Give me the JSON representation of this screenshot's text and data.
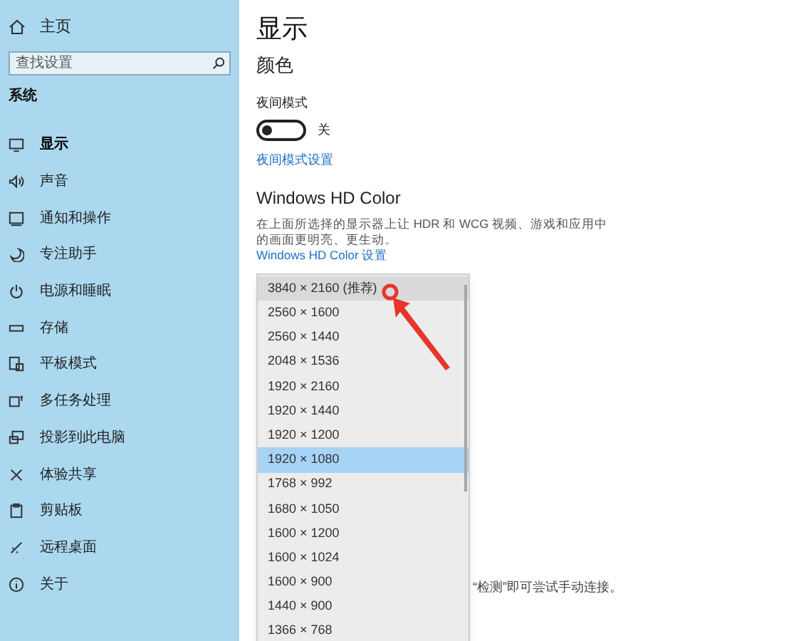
{
  "sidebar": {
    "home": "主页",
    "search": {
      "placeholder": "查找设置"
    },
    "section": "系统",
    "items": [
      {
        "label": "显示",
        "selected": true
      },
      {
        "label": "声音",
        "selected": false
      },
      {
        "label": "通知和操作",
        "selected": false
      },
      {
        "label": "专注助手",
        "selected": false
      },
      {
        "label": "电源和睡眠",
        "selected": false
      },
      {
        "label": "存储",
        "selected": false
      },
      {
        "label": "平板模式",
        "selected": false
      },
      {
        "label": "多任务处理",
        "selected": false
      },
      {
        "label": "投影到此电脑",
        "selected": false
      },
      {
        "label": "体验共享",
        "selected": false
      },
      {
        "label": "剪贴板",
        "selected": false
      },
      {
        "label": "远程桌面",
        "selected": false
      },
      {
        "label": "关于",
        "selected": false
      }
    ]
  },
  "content": {
    "title": "显示",
    "color_heading": "颜色",
    "night_light": {
      "label": "夜间模式",
      "on": false,
      "state": "关"
    },
    "night_link": "夜间模式设置",
    "hd_heading": "Windows HD Color",
    "hd_text": "在上面所选择的显示器上让 HDR 和 WCG 视频、游戏和应用中的画面更明亮、更生动。",
    "hd_link": "Windows HD Color 设置",
    "partial_text": "“检测”即可尝试手动连接。"
  },
  "resolution_dropdown": {
    "options": [
      {
        "label": "3840 × 2160 (推荐)",
        "selected": false,
        "hovered": true
      },
      {
        "label": "2560 × 1600",
        "selected": false,
        "hovered": false
      },
      {
        "label": "2560 × 1440",
        "selected": false,
        "hovered": false
      },
      {
        "label": "2048 × 1536",
        "selected": false,
        "hovered": false
      },
      {
        "label": "1920 × 2160",
        "selected": false,
        "hovered": false
      },
      {
        "label": "1920 × 1440",
        "selected": false,
        "hovered": false
      },
      {
        "label": "1920 × 1200",
        "selected": false,
        "hovered": false
      },
      {
        "label": "1920 × 1080",
        "selected": true,
        "hovered": false
      },
      {
        "label": "1768 × 992",
        "selected": false,
        "hovered": false
      },
      {
        "label": "1680 × 1050",
        "selected": false,
        "hovered": false
      },
      {
        "label": "1600 × 1200",
        "selected": false,
        "hovered": false
      },
      {
        "label": "1600 × 1024",
        "selected": false,
        "hovered": false
      },
      {
        "label": "1600 × 900",
        "selected": false,
        "hovered": false
      },
      {
        "label": "1440 × 900",
        "selected": false,
        "hovered": false
      },
      {
        "label": "1366 × 768",
        "selected": false,
        "hovered": false
      }
    ]
  }
}
